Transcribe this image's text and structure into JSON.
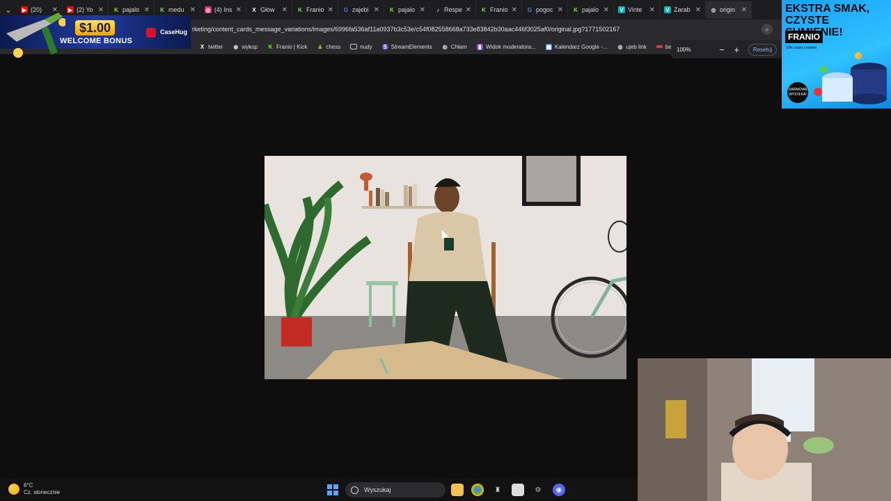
{
  "browser": {
    "tabs": [
      {
        "label": "(20)",
        "icon": "youtube-icon",
        "color": "#ff0000"
      },
      {
        "label": "(2) Yo",
        "icon": "youtube-icon",
        "color": "#ff0000"
      },
      {
        "label": "pajalo",
        "icon": "kick-icon",
        "color": "#53fc18"
      },
      {
        "label": "medu",
        "icon": "kick-icon",
        "color": "#53fc18"
      },
      {
        "label": "(4) Ins",
        "icon": "instagram-icon",
        "color": "#e1306c"
      },
      {
        "label": "Głów",
        "icon": "x-icon",
        "color": "#ffffff"
      },
      {
        "label": "Franio",
        "icon": "kick-icon",
        "color": "#53fc18"
      },
      {
        "label": "zajebi",
        "icon": "google-icon",
        "color": "#4285f4"
      },
      {
        "label": "pajalo",
        "icon": "kick-icon",
        "color": "#53fc18"
      },
      {
        "label": "Respe",
        "icon": "tiktok-icon",
        "color": "#ffffff"
      },
      {
        "label": "Franio",
        "icon": "kick-icon",
        "color": "#53fc18"
      },
      {
        "label": "pogoc",
        "icon": "google-icon",
        "color": "#4285f4"
      },
      {
        "label": "pajalo",
        "icon": "kick-icon",
        "color": "#53fc18"
      },
      {
        "label": "Vinte",
        "icon": "vinted-icon",
        "color": "#09b1ba"
      },
      {
        "label": "Zarab",
        "icon": "vinted-icon",
        "color": "#09b1ba"
      },
      {
        "label": "origin",
        "icon": "globe-icon",
        "color": "#bbbbbb"
      }
    ],
    "url": "rketing/content_cards_message_variations/images/6996fa536af11a0937b3c53e/c54f082558668a733e83842b30aac446f3025af0/original.jpg?1771502167",
    "bookmarks": [
      {
        "label": "twitter",
        "icon": "x-icon",
        "color": "#ffffff"
      },
      {
        "label": "wykop",
        "icon": "wykop-icon",
        "color": "#cccccc"
      },
      {
        "label": "Franio | Kick",
        "icon": "kick-icon",
        "color": "#53fc18"
      },
      {
        "label": "chess",
        "icon": "chess-icon",
        "color": "#81b64c"
      },
      {
        "label": "nudy",
        "icon": "folder-icon",
        "color": "#cccccc"
      },
      {
        "label": "StreamElements",
        "icon": "streamelements-icon",
        "color": "#5b4ae0"
      },
      {
        "label": "Chłam",
        "icon": "globe-icon",
        "color": "#cccccc"
      },
      {
        "label": "Widok moderatora...",
        "icon": "twitch-icon",
        "color": "#9146ff"
      },
      {
        "label": "Kalendarz Google -...",
        "icon": "calendar-icon",
        "color": "#4285f4"
      },
      {
        "label": "ujeb link",
        "icon": "globe-icon",
        "color": "#cccccc"
      },
      {
        "label": "be",
        "icon": "bookmark-icon",
        "color": "#e53935"
      }
    ],
    "zoom": {
      "percent": "100%",
      "minus": "−",
      "plus": "+",
      "reset": "Resetuj"
    }
  },
  "ads": {
    "left": {
      "amount": "$1.00",
      "text": "WELCOME BONUS",
      "brand": "CaseHug"
    },
    "right": {
      "title": "EKSTRA SMAK, CZYSTE SUMIENIE!",
      "brand": "FRANIO",
      "subtitle": "10% zniżki z kodem",
      "badge": "DARMOWA WYSYŁKA!"
    }
  },
  "taskbar": {
    "weather_temp": "6°C",
    "weather_desc": "Cz. słonecznie",
    "search_placeholder": "Wyszukaj"
  }
}
